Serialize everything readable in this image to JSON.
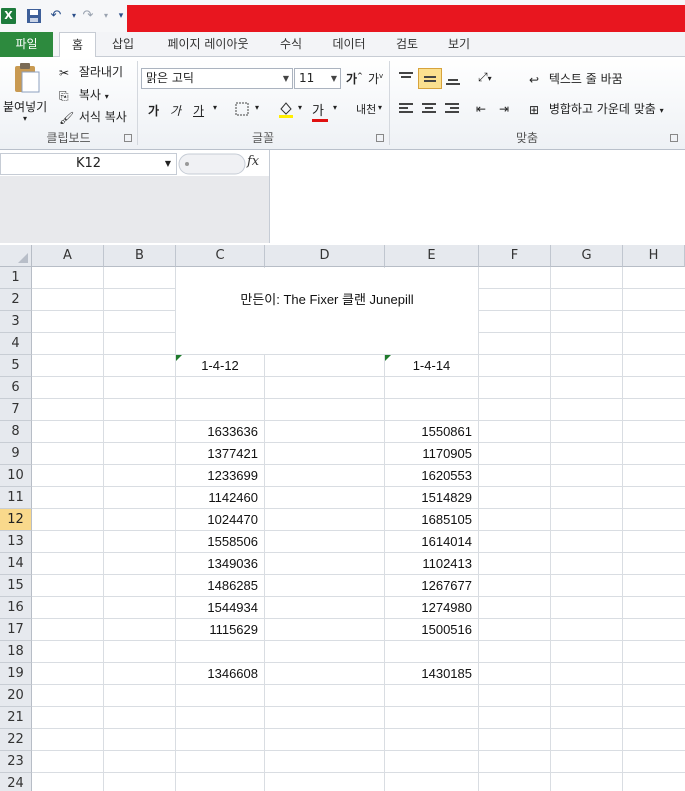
{
  "quick_access": {
    "icons": [
      "excel-icon",
      "save-icon",
      "undo-icon",
      "redo-icon",
      "customize-icon"
    ]
  },
  "tabs": [
    "파일",
    "홈",
    "삽입",
    "페이지 레이아웃",
    "수식",
    "데이터",
    "검토",
    "보기"
  ],
  "clipboard": {
    "paste": "붙여넣기",
    "cut": "잘라내기",
    "copy": "복사",
    "format_painter": "서식 복사",
    "group": "클립보드"
  },
  "font": {
    "name": "맑은 고딕",
    "size": "11",
    "bold": "가",
    "italic": "가",
    "underline": "가",
    "group": "글꼴"
  },
  "alignment": {
    "wrap_text": "텍스트 줄 바꿈",
    "merge_center": "병합하고 가운데 맞춤",
    "group": "맞춤"
  },
  "formula_bar": {
    "name_box": "K12",
    "fx": "fx",
    "value": ""
  },
  "sheet": {
    "columns": [
      "A",
      "B",
      "C",
      "D",
      "E",
      "F",
      "G",
      "H"
    ],
    "rows": [
      "1",
      "2",
      "3",
      "4",
      "5",
      "6",
      "7",
      "8",
      "9",
      "10",
      "11",
      "12",
      "13",
      "14",
      "15",
      "16",
      "17",
      "18",
      "19",
      "20",
      "21",
      "22",
      "23",
      "24"
    ],
    "selected_row": "12",
    "title": "만든이: The Fixer 클랜 Junepill",
    "c5": "1-4-12",
    "e5": "1-4-14",
    "c_values": [
      "1633636",
      "1377421",
      "1233699",
      "1142460",
      "1024470",
      "1558506",
      "1349036",
      "1486285",
      "1544934",
      "1115629"
    ],
    "e_values": [
      "1550861",
      "1170905",
      "1620553",
      "1514829",
      "1685105",
      "1614014",
      "1102413",
      "1267677",
      "1274980",
      "1500516"
    ],
    "c19": "1346608",
    "e19": "1430185"
  }
}
